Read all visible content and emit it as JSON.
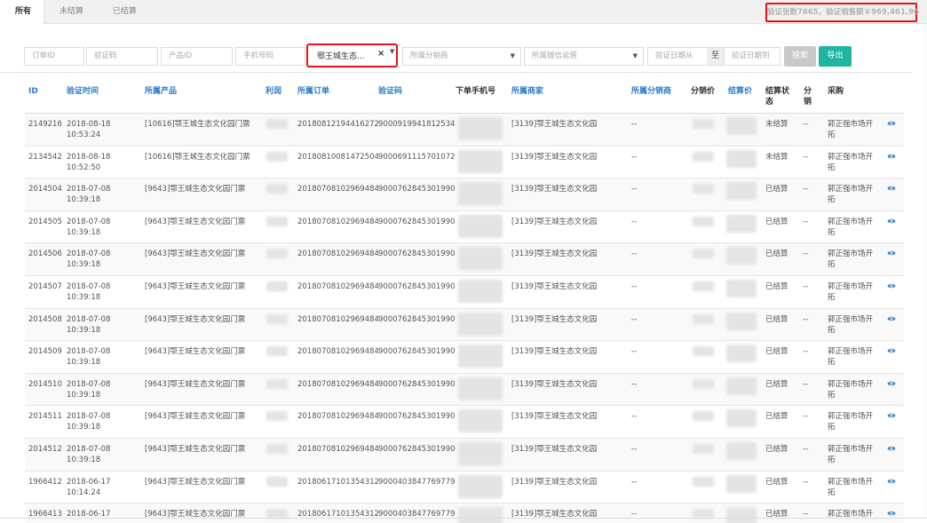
{
  "tabs": [
    {
      "label": "所有",
      "active": true
    },
    {
      "label": "未结算",
      "active": false
    },
    {
      "label": "已结算",
      "active": false
    }
  ],
  "summary_text": "验证张数7665，验证销售额￥969,461.96",
  "filters": {
    "order_id_placeholder": "订单ID",
    "verify_code_placeholder": "验证码",
    "product_id_placeholder": "产品ID",
    "phone_placeholder": "手机号码",
    "merchant_selected": "鄂王城生态...",
    "distributor_placeholder": "所属分销商",
    "wechat_placeholder": "所属微信运营",
    "date_from_placeholder": "验证日期从",
    "date_to_label": "至",
    "date_to_placeholder": "验证日期到"
  },
  "buttons": {
    "search": "搜索",
    "export": "导出"
  },
  "columns": {
    "id": "ID",
    "time": "验证时间",
    "product": "所属产品",
    "profit": "利润",
    "order": "所属订单",
    "code": "验证码",
    "phone": "下单手机号",
    "merchant": "所属商家",
    "distributor": "所属分销商",
    "sale_price": "分销价",
    "settle_price": "结算价",
    "status_line1": "结算状",
    "status_line2": "态",
    "split_line1": "分",
    "split_line2": "销",
    "purchase": "采购"
  },
  "rows": [
    {
      "id": "2149216",
      "date": "2018-08-18",
      "time": "10:53:24",
      "product": "[10616]鄂王城生态文化园门票",
      "order": "20180812194416272",
      "code": "9000919941812534",
      "merchant": "[3139]鄂王城生态文化园",
      "distributor": "--",
      "status": "未结算",
      "split": "--",
      "purchase1": "郭正强市场开",
      "purchase2": "拓"
    },
    {
      "id": "2134542",
      "date": "2018-08-18",
      "time": "10:52:50",
      "product": "[10616]鄂王城生态文化园门票",
      "order": "20180810081472504",
      "code": "9000691115701072",
      "merchant": "[3139]鄂王城生态文化园",
      "distributor": "--",
      "status": "未结算",
      "split": "--",
      "purchase1": "郭正强市场开",
      "purchase2": "拓"
    },
    {
      "id": "2014504",
      "date": "2018-07-08",
      "time": "10:39:18",
      "product": "[9643]鄂王城生态文化园门票",
      "order": "20180708102969484",
      "code": "9000762845301990",
      "merchant": "[3139]鄂王城生态文化园",
      "distributor": "--",
      "status": "已结算",
      "split": "--",
      "purchase1": "郭正强市场开",
      "purchase2": "拓"
    },
    {
      "id": "2014505",
      "date": "2018-07-08",
      "time": "10:39:18",
      "product": "[9643]鄂王城生态文化园门票",
      "order": "20180708102969484",
      "code": "9000762845301990",
      "merchant": "[3139]鄂王城生态文化园",
      "distributor": "--",
      "status": "已结算",
      "split": "--",
      "purchase1": "郭正强市场开",
      "purchase2": "拓"
    },
    {
      "id": "2014506",
      "date": "2018-07-08",
      "time": "10:39:18",
      "product": "[9643]鄂王城生态文化园门票",
      "order": "20180708102969484",
      "code": "9000762845301990",
      "merchant": "[3139]鄂王城生态文化园",
      "distributor": "--",
      "status": "已结算",
      "split": "--",
      "purchase1": "郭正强市场开",
      "purchase2": "拓"
    },
    {
      "id": "2014507",
      "date": "2018-07-08",
      "time": "10:39:18",
      "product": "[9643]鄂王城生态文化园门票",
      "order": "20180708102969484",
      "code": "9000762845301990",
      "merchant": "[3139]鄂王城生态文化园",
      "distributor": "--",
      "status": "已结算",
      "split": "--",
      "purchase1": "郭正强市场开",
      "purchase2": "拓"
    },
    {
      "id": "2014508",
      "date": "2018-07-08",
      "time": "10:39:18",
      "product": "[9643]鄂王城生态文化园门票",
      "order": "20180708102969484",
      "code": "9000762845301990",
      "merchant": "[3139]鄂王城生态文化园",
      "distributor": "--",
      "status": "已结算",
      "split": "--",
      "purchase1": "郭正强市场开",
      "purchase2": "拓"
    },
    {
      "id": "2014509",
      "date": "2018-07-08",
      "time": "10:39:18",
      "product": "[9643]鄂王城生态文化园门票",
      "order": "20180708102969484",
      "code": "9000762845301990",
      "merchant": "[3139]鄂王城生态文化园",
      "distributor": "--",
      "status": "已结算",
      "split": "--",
      "purchase1": "郭正强市场开",
      "purchase2": "拓"
    },
    {
      "id": "2014510",
      "date": "2018-07-08",
      "time": "10:39:18",
      "product": "[9643]鄂王城生态文化园门票",
      "order": "20180708102969484",
      "code": "9000762845301990",
      "merchant": "[3139]鄂王城生态文化园",
      "distributor": "--",
      "status": "已结算",
      "split": "--",
      "purchase1": "郭正强市场开",
      "purchase2": "拓"
    },
    {
      "id": "2014511",
      "date": "2018-07-08",
      "time": "10:39:18",
      "product": "[9643]鄂王城生态文化园门票",
      "order": "20180708102969484",
      "code": "9000762845301990",
      "merchant": "[3139]鄂王城生态文化园",
      "distributor": "--",
      "status": "已结算",
      "split": "--",
      "purchase1": "郭正强市场开",
      "purchase2": "拓"
    },
    {
      "id": "2014512",
      "date": "2018-07-08",
      "time": "10:39:18",
      "product": "[9643]鄂王城生态文化园门票",
      "order": "20180708102969484",
      "code": "9000762845301990",
      "merchant": "[3139]鄂王城生态文化园",
      "distributor": "--",
      "status": "已结算",
      "split": "--",
      "purchase1": "郭正强市场开",
      "purchase2": "拓"
    },
    {
      "id": "1966412",
      "date": "2018-06-17",
      "time": "10:14:24",
      "product": "[9643]鄂王城生态文化园门票",
      "order": "20180617101354312",
      "code": "9000403847769779",
      "merchant": "[3139]鄂王城生态文化园",
      "distributor": "--",
      "status": "已结算",
      "split": "--",
      "purchase1": "郭正强市场开",
      "purchase2": "拓"
    },
    {
      "id": "1966413",
      "date": "2018-06-17",
      "time": "",
      "product": "[9643]鄂王城生态文化园门票",
      "order": "20180617101354312",
      "code": "9000403847769779",
      "merchant": "[3139]鄂王城生态文化园",
      "distributor": "--",
      "status": "已结算",
      "split": "--",
      "purchase1": "郭正强市场开",
      "purchase2": ""
    }
  ],
  "icons": {
    "view": "eye-icon"
  },
  "colors": {
    "accent_blue": "#2e7cc9",
    "export_green": "#1fb5a0",
    "highlight_red": "#e8101a"
  }
}
